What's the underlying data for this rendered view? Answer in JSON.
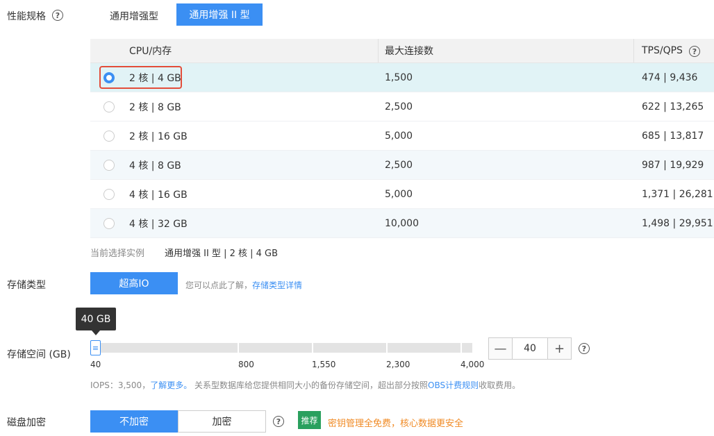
{
  "perf_spec": {
    "label": "性能规格",
    "help_icon": "question-circle-icon",
    "tabs": [
      {
        "label": "通用增强型",
        "active": false
      },
      {
        "label": "通用增强 II 型",
        "active": true
      }
    ]
  },
  "spec_table": {
    "headers": [
      "CPU/内存",
      "最大连接数",
      "TPS/QPS"
    ],
    "rows": [
      {
        "cpu_mem": "2 核 | 4 GB",
        "max_conn": "1,500",
        "tps_qps": "474 | 9,436",
        "selected": true
      },
      {
        "cpu_mem": "2 核 | 8 GB",
        "max_conn": "2,500",
        "tps_qps": "622 | 13,265",
        "selected": false
      },
      {
        "cpu_mem": "2 核 | 16 GB",
        "max_conn": "5,000",
        "tps_qps": "685 | 13,817",
        "selected": false
      },
      {
        "cpu_mem": "4 核 | 8 GB",
        "max_conn": "2,500",
        "tps_qps": "987 | 19,929",
        "selected": false
      },
      {
        "cpu_mem": "4 核 | 16 GB",
        "max_conn": "5,000",
        "tps_qps": "1,371 | 26,281",
        "selected": false
      },
      {
        "cpu_mem": "4 核 | 32 GB",
        "max_conn": "10,000",
        "tps_qps": "1,498 | 29,951",
        "selected": false
      }
    ]
  },
  "current_selection": {
    "label": "当前选择实例",
    "value": "通用增强 II 型 | 2 核 | 4 GB"
  },
  "storage_type": {
    "label": "存储类型",
    "button": "超高IO",
    "hint": "您可以点此了解，",
    "link": "存储类型详情"
  },
  "storage_space": {
    "label": "存储空间 (GB)",
    "tooltip": "40 GB",
    "ticks": [
      "40",
      "800",
      "1,550",
      "2,300",
      "4,000"
    ],
    "value": "40",
    "minus": "—",
    "plus": "+",
    "note_prefix": "IOPS：3,500，",
    "note_link1": "了解更多。",
    "note_mid": " 关系型数据库给您提供相同大小的备份存储空间，超出部分按照",
    "note_link2": "OBS计费规则",
    "note_suffix": "收取费用。"
  },
  "disk_encryption": {
    "label": "磁盘加密",
    "options": [
      {
        "label": "不加密",
        "active": true
      },
      {
        "label": "加密",
        "active": false
      }
    ],
    "badge": "推荐",
    "promo": "密钥管理全免费，核心数据更安全"
  },
  "colors": {
    "primary": "#3b8ff3",
    "selected_row": "#e1f3f6",
    "highlight_border": "#e34d3a",
    "recommend_green": "#2aa05e",
    "promo_orange": "#f08a24"
  }
}
